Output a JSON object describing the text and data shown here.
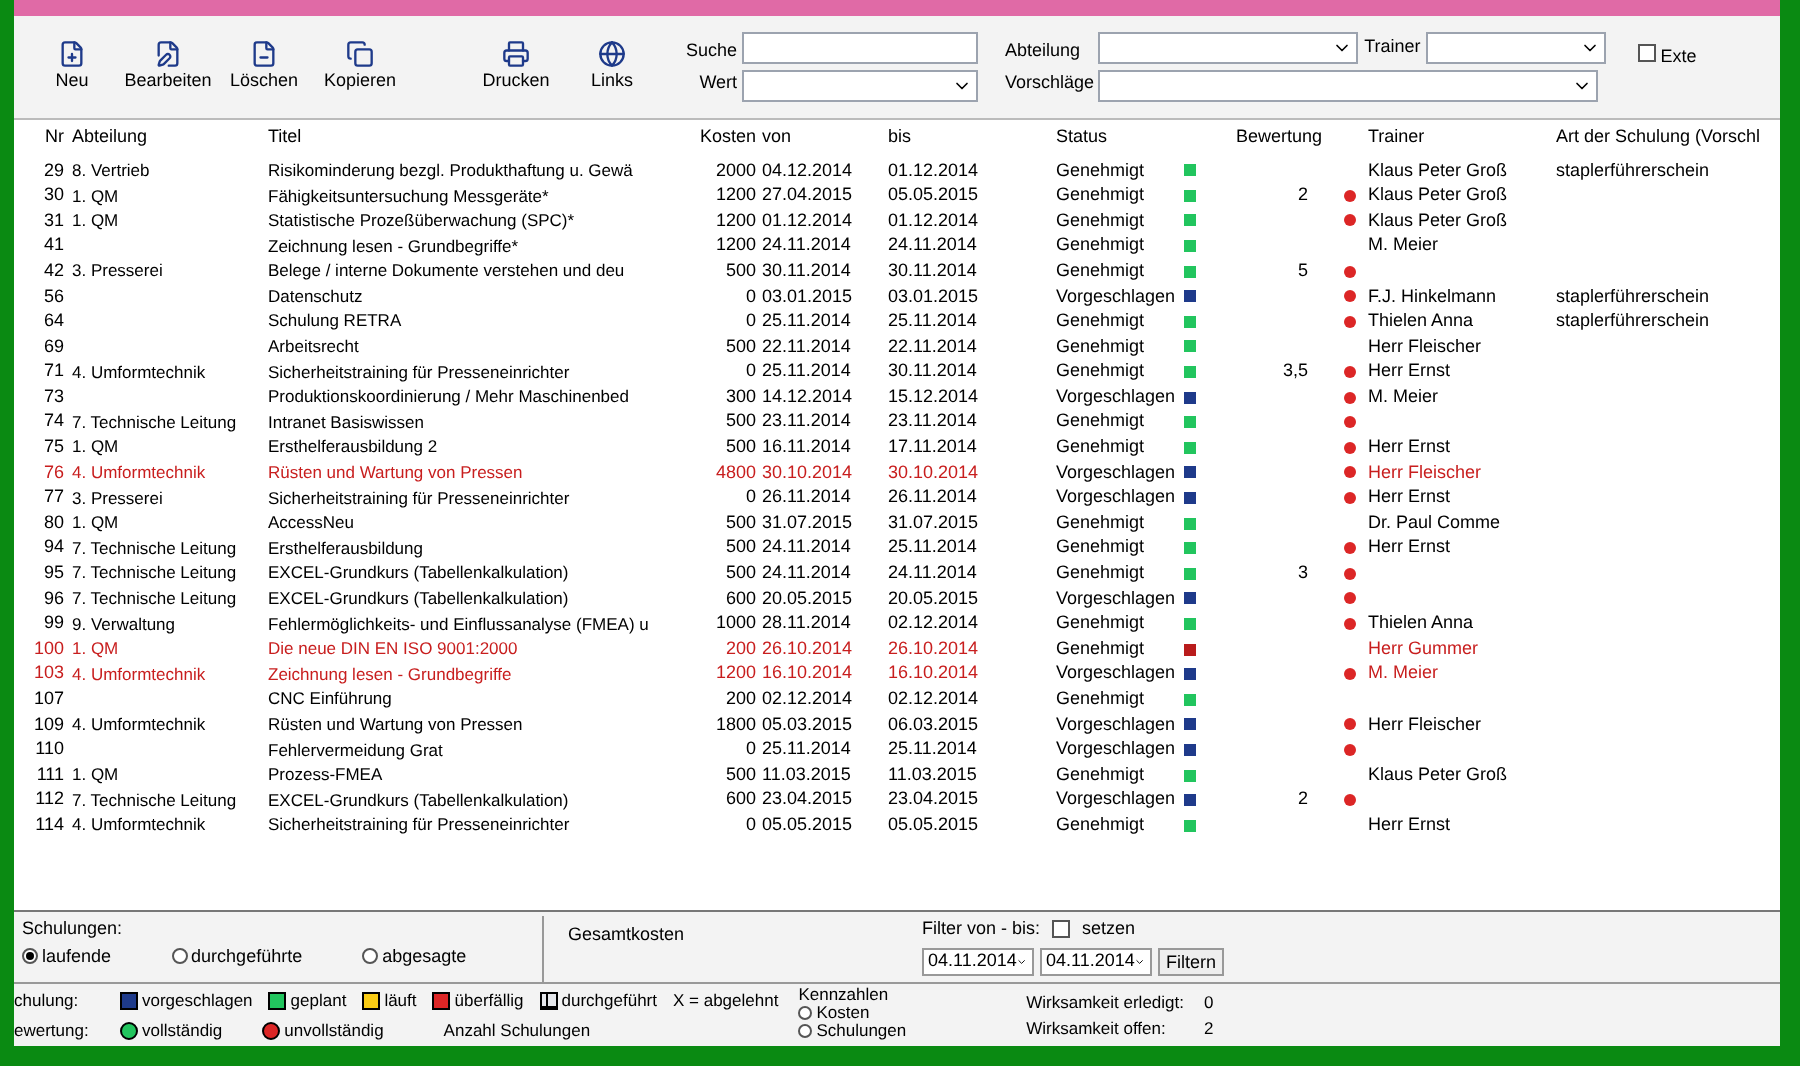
{
  "toolbar": {
    "buttons": [
      {
        "label": "Neu",
        "kind": "new"
      },
      {
        "label": "Bearbeiten",
        "kind": "edit"
      },
      {
        "label": "Löschen",
        "kind": "delete"
      },
      {
        "label": "Kopieren",
        "kind": "copy"
      },
      {
        "label": "Drucken",
        "kind": "print"
      },
      {
        "label": "Links",
        "kind": "links"
      }
    ],
    "search_label": "Suche",
    "value_label": "Wert",
    "department_label": "Abteilung",
    "proposals_label": "Vorschläge",
    "trainer_label": "Trainer",
    "external": {
      "label": "Exte",
      "checked": false
    }
  },
  "table": {
    "columns": [
      "Nr",
      "Abteilung",
      "Titel",
      "Kosten",
      "von",
      "bis",
      "Status",
      "Bewertung",
      "Trainer",
      "Art der Schulung (Vorschl"
    ],
    "rows": [
      {
        "nr": "29",
        "abteilung": "8. Vertrieb",
        "titel": "Risikominderung bezgl. Produkthaftung u. Gewä",
        "kosten": "2000",
        "von": "04.12.2014",
        "bis": "01.12.2014",
        "status": "Genehmigt",
        "color": "#22c55e",
        "bewertung": "",
        "incomplete": false,
        "trainer": "Klaus Peter Groß",
        "art": "staplerführerschein",
        "overdue": false
      },
      {
        "nr": "30",
        "abteilung": "1. QM",
        "titel": "Fähigkeitsuntersuchung Messgeräte*",
        "kosten": "1200",
        "von": "27.04.2015",
        "bis": "05.05.2015",
        "status": "Genehmigt",
        "color": "#22c55e",
        "bewertung": "2",
        "incomplete": true,
        "trainer": "Klaus Peter Groß",
        "art": "",
        "overdue": false
      },
      {
        "nr": "31",
        "abteilung": "1. QM",
        "titel": "Statistische Prozeßüberwachung (SPC)*",
        "kosten": "1200",
        "von": "01.12.2014",
        "bis": "01.12.2014",
        "status": "Genehmigt",
        "color": "#22c55e",
        "bewertung": "",
        "incomplete": true,
        "trainer": "Klaus Peter Groß",
        "art": "",
        "overdue": false
      },
      {
        "nr": "41",
        "abteilung": "",
        "titel": "Zeichnung lesen - Grundbegriffe*",
        "kosten": "1200",
        "von": "24.11.2014",
        "bis": "24.11.2014",
        "status": "Genehmigt",
        "color": "#22c55e",
        "bewertung": "",
        "incomplete": false,
        "trainer": "M. Meier",
        "art": "",
        "overdue": false
      },
      {
        "nr": "42",
        "abteilung": "3. Presserei",
        "titel": "Belege / interne Dokumente verstehen und deu",
        "kosten": "500",
        "von": "30.11.2014",
        "bis": "30.11.2014",
        "status": "Genehmigt",
        "color": "#22c55e",
        "bewertung": "5",
        "incomplete": true,
        "trainer": "",
        "art": "",
        "overdue": false
      },
      {
        "nr": "56",
        "abteilung": "",
        "titel": "Datenschutz",
        "kosten": "0",
        "von": "03.01.2015",
        "bis": "03.01.2015",
        "status": "Vorgeschlagen",
        "color": "#1e3a8a",
        "bewertung": "",
        "incomplete": true,
        "trainer": "F.J. Hinkelmann",
        "art": "staplerführerschein",
        "overdue": false
      },
      {
        "nr": "64",
        "abteilung": "",
        "titel": "Schulung RETRA",
        "kosten": "0",
        "von": "25.11.2014",
        "bis": "25.11.2014",
        "status": "Genehmigt",
        "color": "#22c55e",
        "bewertung": "",
        "incomplete": true,
        "trainer": "Thielen Anna",
        "art": "staplerführerschein",
        "overdue": false
      },
      {
        "nr": "69",
        "abteilung": "",
        "titel": "Arbeitsrecht",
        "kosten": "500",
        "von": "22.11.2014",
        "bis": "22.11.2014",
        "status": "Genehmigt",
        "color": "#22c55e",
        "bewertung": "",
        "incomplete": false,
        "trainer": "Herr Fleischer",
        "art": "",
        "overdue": false
      },
      {
        "nr": "71",
        "abteilung": "4. Umformtechnik",
        "titel": "Sicherheitstraining für Presseneinrichter",
        "kosten": "0",
        "von": "25.11.2014",
        "bis": "30.11.2014",
        "status": "Genehmigt",
        "color": "#22c55e",
        "bewertung": "3,5",
        "incomplete": true,
        "trainer": "Herr Ernst",
        "art": "",
        "overdue": false
      },
      {
        "nr": "73",
        "abteilung": "",
        "titel": "Produktionskoordinierung / Mehr Maschinenbed",
        "kosten": "300",
        "von": "14.12.2014",
        "bis": "15.12.2014",
        "status": "Vorgeschlagen",
        "color": "#1e3a8a",
        "bewertung": "",
        "incomplete": true,
        "trainer": "M. Meier",
        "art": "",
        "overdue": false
      },
      {
        "nr": "74",
        "abteilung": "7. Technische Leitung",
        "titel": "Intranet Basiswissen",
        "kosten": "500",
        "von": "23.11.2014",
        "bis": "23.11.2014",
        "status": "Genehmigt",
        "color": "#22c55e",
        "bewertung": "",
        "incomplete": true,
        "trainer": "",
        "art": "",
        "overdue": false
      },
      {
        "nr": "75",
        "abteilung": "1. QM",
        "titel": "Ersthelferausbildung 2",
        "kosten": "500",
        "von": "16.11.2014",
        "bis": "17.11.2014",
        "status": "Genehmigt",
        "color": "#22c55e",
        "bewertung": "",
        "incomplete": true,
        "trainer": "Herr Ernst",
        "art": "",
        "overdue": false
      },
      {
        "nr": "76",
        "abteilung": "4. Umformtechnik",
        "titel": "Rüsten und Wartung von Pressen",
        "kosten": "4800",
        "von": "30.10.2014",
        "bis": "30.10.2014",
        "status": "Vorgeschlagen",
        "color": "#1e3a8a",
        "bewertung": "",
        "incomplete": true,
        "trainer": "Herr Fleischer",
        "art": "",
        "overdue": true
      },
      {
        "nr": "77",
        "abteilung": "3. Presserei",
        "titel": "Sicherheitstraining für Presseneinrichter",
        "kosten": "0",
        "von": "26.11.2014",
        "bis": "26.11.2014",
        "status": "Vorgeschlagen",
        "color": "#1e3a8a",
        "bewertung": "",
        "incomplete": true,
        "trainer": "Herr Ernst",
        "art": "",
        "overdue": false
      },
      {
        "nr": "80",
        "abteilung": "1. QM",
        "titel": "AccessNeu",
        "kosten": "500",
        "von": "31.07.2015",
        "bis": "31.07.2015",
        "status": "Genehmigt",
        "color": "#22c55e",
        "bewertung": "",
        "incomplete": false,
        "trainer": "Dr. Paul Comme",
        "art": "",
        "overdue": false
      },
      {
        "nr": "94",
        "abteilung": "7. Technische Leitung",
        "titel": "Ersthelferausbildung",
        "kosten": "500",
        "von": "24.11.2014",
        "bis": "25.11.2014",
        "status": "Genehmigt",
        "color": "#22c55e",
        "bewertung": "",
        "incomplete": true,
        "trainer": "Herr Ernst",
        "art": "",
        "overdue": false
      },
      {
        "nr": "95",
        "abteilung": "7. Technische Leitung",
        "titel": "EXCEL-Grundkurs (Tabellenkalkulation)",
        "kosten": "500",
        "von": "24.11.2014",
        "bis": "24.11.2014",
        "status": "Genehmigt",
        "color": "#22c55e",
        "bewertung": "3",
        "incomplete": true,
        "trainer": "",
        "art": "",
        "overdue": false
      },
      {
        "nr": "96",
        "abteilung": "7. Technische Leitung",
        "titel": "EXCEL-Grundkurs (Tabellenkalkulation)",
        "kosten": "600",
        "von": "20.05.2015",
        "bis": "20.05.2015",
        "status": "Vorgeschlagen",
        "color": "#1e3a8a",
        "bewertung": "",
        "incomplete": true,
        "trainer": "",
        "art": "",
        "overdue": false
      },
      {
        "nr": "99",
        "abteilung": "9. Verwaltung",
        "titel": "Fehlermöglichkeits- und Einflussanalyse (FMEA) u",
        "kosten": "1000",
        "von": "28.11.2014",
        "bis": "02.12.2014",
        "status": "Genehmigt",
        "color": "#22c55e",
        "bewertung": "",
        "incomplete": true,
        "trainer": "Thielen Anna",
        "art": "",
        "overdue": false
      },
      {
        "nr": "100",
        "abteilung": "1. QM",
        "titel": "Die neue DIN EN ISO 9001:2000",
        "kosten": "200",
        "von": "26.10.2014",
        "bis": "26.10.2014",
        "status": "Genehmigt",
        "color": "#b91c1c",
        "bewertung": "",
        "incomplete": false,
        "trainer": "Herr Gummer",
        "art": "",
        "overdue": true
      },
      {
        "nr": "103",
        "abteilung": "4. Umformtechnik",
        "titel": "Zeichnung lesen - Grundbegriffe",
        "kosten": "1200",
        "von": "16.10.2014",
        "bis": "16.10.2014",
        "status": "Vorgeschlagen",
        "color": "#1e3a8a",
        "bewertung": "",
        "incomplete": true,
        "trainer": "M. Meier",
        "art": "",
        "overdue": true
      },
      {
        "nr": "107",
        "abteilung": "",
        "titel": "CNC Einführung",
        "kosten": "200",
        "von": "02.12.2014",
        "bis": "02.12.2014",
        "status": "Genehmigt",
        "color": "#22c55e",
        "bewertung": "",
        "incomplete": false,
        "trainer": "",
        "art": "",
        "overdue": false
      },
      {
        "nr": "109",
        "abteilung": "4. Umformtechnik",
        "titel": "Rüsten und Wartung von Pressen",
        "kosten": "1800",
        "von": "05.03.2015",
        "bis": "06.03.2015",
        "status": "Vorgeschlagen",
        "color": "#1e3a8a",
        "bewertung": "",
        "incomplete": true,
        "trainer": "Herr Fleischer",
        "art": "",
        "overdue": false
      },
      {
        "nr": "110",
        "abteilung": "",
        "titel": "Fehlervermeidung Grat",
        "kosten": "0",
        "von": "25.11.2014",
        "bis": "25.11.2014",
        "status": "Vorgeschlagen",
        "color": "#1e3a8a",
        "bewertung": "",
        "incomplete": true,
        "trainer": "",
        "art": "",
        "overdue": false
      },
      {
        "nr": "111",
        "abteilung": "1. QM",
        "titel": "Prozess-FMEA",
        "kosten": "500",
        "von": "11.03.2015",
        "bis": "11.03.2015",
        "status": "Genehmigt",
        "color": "#22c55e",
        "bewertung": "",
        "incomplete": false,
        "trainer": "Klaus Peter Groß",
        "art": "",
        "overdue": false
      },
      {
        "nr": "112",
        "abteilung": "7. Technische Leitung",
        "titel": "EXCEL-Grundkurs (Tabellenkalkulation)",
        "kosten": "600",
        "von": "23.04.2015",
        "bis": "23.04.2015",
        "status": "Vorgeschlagen",
        "color": "#1e3a8a",
        "bewertung": "2",
        "incomplete": true,
        "trainer": "",
        "art": "",
        "overdue": false
      },
      {
        "nr": "114",
        "abteilung": "4. Umformtechnik",
        "titel": "Sicherheitstraining für Presseneinrichter",
        "kosten": "0",
        "von": "05.05.2015",
        "bis": "05.05.2015",
        "status": "Genehmigt",
        "color": "#22c55e",
        "bewertung": "",
        "incomplete": false,
        "trainer": "Herr Ernst",
        "art": "",
        "overdue": false
      }
    ]
  },
  "filters": {
    "trainings_label": "Schulungen:",
    "radios": [
      {
        "label": "laufende",
        "selected": true
      },
      {
        "label": "durchgeführte",
        "selected": false
      },
      {
        "label": "abgesagte",
        "selected": false
      }
    ],
    "total_cost_label": "Gesamtkosten",
    "filter_label": "Filter von - bis:",
    "set": {
      "label": "setzen",
      "checked": false
    },
    "from": "04.11.2014",
    "to": "04.11.2014",
    "filter_button": "Filtern"
  },
  "legend": {
    "training_label": "chulung:",
    "items": [
      {
        "label": "vorgeschlagen",
        "kind": "proposed"
      },
      {
        "label": "geplant",
        "kind": "planned"
      },
      {
        "label": "läuft",
        "kind": "running"
      },
      {
        "label": "überfällig",
        "kind": "overdue"
      },
      {
        "label": "durchgeführt",
        "kind": "done"
      },
      {
        "label": "X = abgelehnt",
        "kind": "text"
      }
    ],
    "rating_label": "ewertung:",
    "ratings": [
      {
        "label": "vollständig",
        "color": "#22c55e"
      },
      {
        "label": "unvollständig",
        "color": "#dc2626"
      }
    ],
    "count_label": "Anzahl Schulungen",
    "kpi_label": "Kennzahlen",
    "kpi": [
      {
        "label": "Kosten",
        "selected": false
      },
      {
        "label": "Schulungen",
        "selected": false
      }
    ],
    "done_label": "Wirksamkeit erledigt:",
    "done_value": "0",
    "open_label": "Wirksamkeit offen:",
    "open_value": "2"
  }
}
